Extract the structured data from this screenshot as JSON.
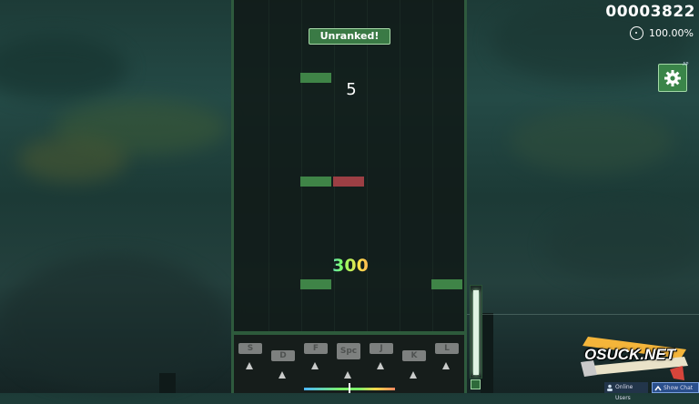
{
  "hud": {
    "score": "00003822",
    "accuracy": "100.00%",
    "combo": "5",
    "judgement": "300",
    "unranked_label": "Unranked!",
    "settings_badge": "AP",
    "health_fraction": 0.92
  },
  "keys": [
    {
      "label": "S"
    },
    {
      "label": "D"
    },
    {
      "label": "F"
    },
    {
      "label": "Spc"
    },
    {
      "label": "J"
    },
    {
      "label": "K"
    },
    {
      "label": "L"
    }
  ],
  "notes_colors": {
    "normal": "#3f8447",
    "highlight": "#9c3f44"
  },
  "watermark": {
    "text": "OSUCK.NET"
  },
  "chat": {
    "online_users": "Online Users",
    "show_chat": "Show Chat"
  },
  "icons": {
    "accuracy": "circle-target-icon",
    "settings": "gear-icon",
    "chat_toggle": "chevron-up-icon",
    "online_users": "users-icon"
  }
}
